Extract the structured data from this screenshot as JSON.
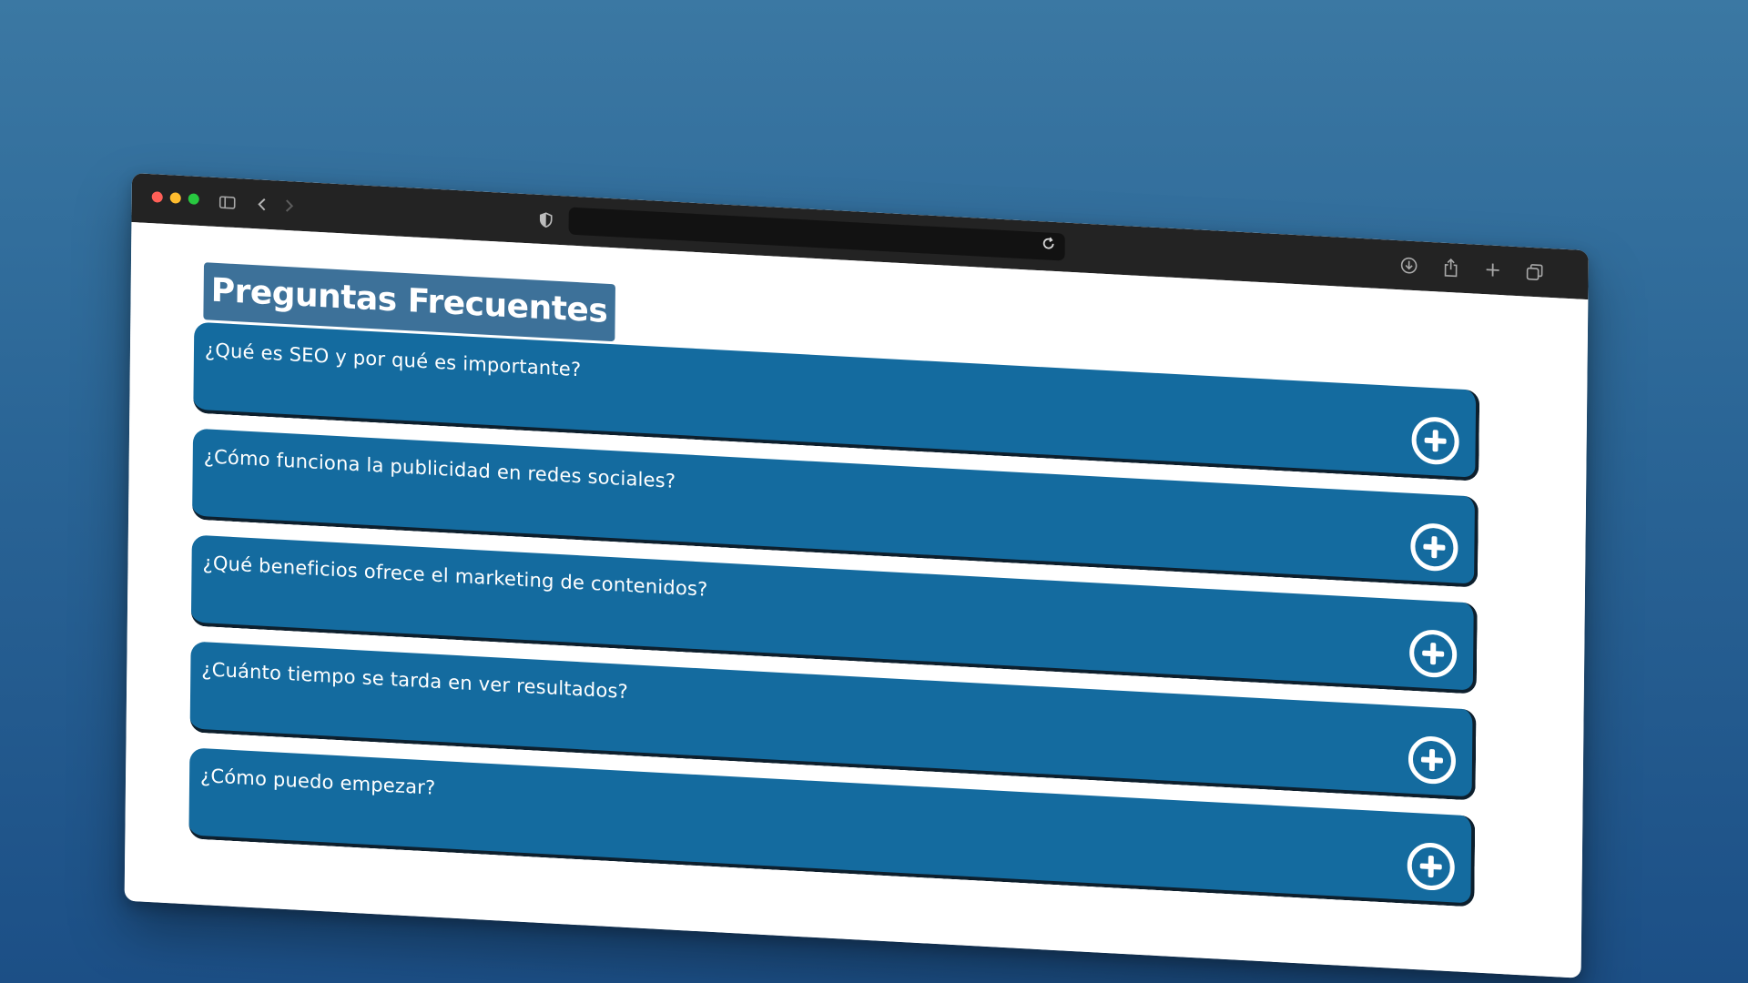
{
  "colors": {
    "accent": "#146b9f",
    "title_badge": "#3d7199",
    "toolbar": "#232323",
    "traffic_close": "#ff5f57",
    "traffic_minimize": "#febc2e",
    "traffic_zoom": "#28c840"
  },
  "browser": {
    "icons": {
      "sidebar": "sidebar-toggle-icon",
      "back": "chevron-left-icon",
      "forward": "chevron-right-icon",
      "privacy": "shield-icon",
      "reload": "reload-icon",
      "download": "download-icon",
      "share": "share-icon",
      "new_tab": "plus-icon",
      "tabs": "tab-overview-icon"
    }
  },
  "page": {
    "title": "Preguntas Frecuentes",
    "faq": [
      {
        "question": "¿Qué es SEO y por qué es importante?",
        "icon": "plus-circle-icon"
      },
      {
        "question": "¿Cómo funciona la publicidad en redes sociales?",
        "icon": "plus-circle-icon"
      },
      {
        "question": "¿Qué beneficios ofrece el marketing de contenidos?",
        "icon": "plus-circle-icon"
      },
      {
        "question": "¿Cuánto tiempo se tarda en ver resultados?",
        "icon": "plus-circle-icon"
      },
      {
        "question": "¿Cómo puedo empezar?",
        "icon": "plus-circle-icon"
      }
    ]
  }
}
